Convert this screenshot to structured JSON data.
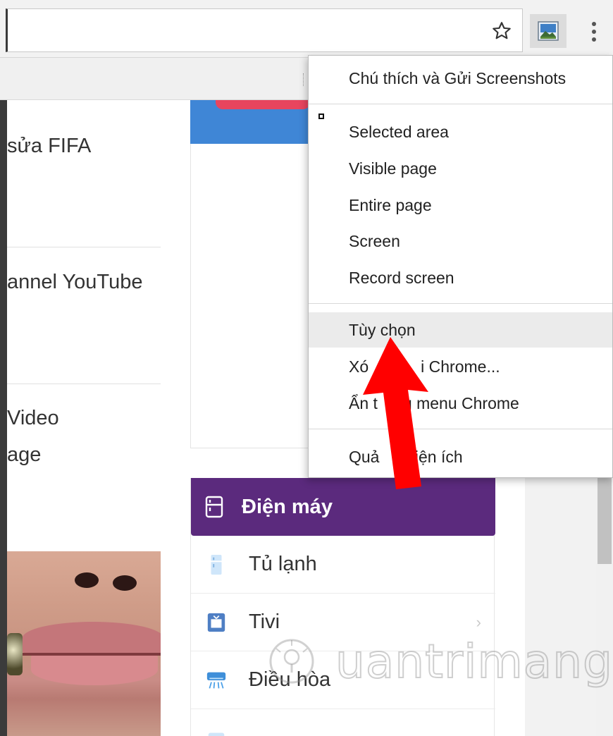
{
  "context_menu": {
    "title_item": "Chú thích và Gửi Screenshots",
    "capture_items": [
      "Selected area",
      "Visible page",
      "Entire page",
      "Screen",
      "Record screen"
    ],
    "option_items": [
      "Tùy chọn",
      "Xóa khỏi Chrome...",
      "Ẩn trong menu Chrome"
    ],
    "manage_item": "Quản lý tiện ích",
    "visible_option_items": [
      "Tùy chọn",
      "Xó",
      "i Chrome...",
      "Ẩn t",
      "g menu Chrome"
    ],
    "visible_manage_item": [
      "Quả",
      "tiện ích"
    ]
  },
  "articles": [
    "sửa FIFA",
    "annel YouTube",
    "Video",
    "age"
  ],
  "categories": {
    "header": "Điện máy",
    "items": [
      "Tủ lạnh",
      "Tivi",
      "Điều hòa"
    ],
    "accent_color": "#5b2a7d"
  },
  "watermark": {
    "text": "uantrimang"
  },
  "colors": {
    "arrow": "#ff0000",
    "hero": "#3f86d6",
    "hero_pill": "#e8455e"
  },
  "icons": {
    "star": "star-icon",
    "extension": "screenshot-extension-icon",
    "menu": "kebab-menu-icon",
    "fridge": "fridge-icon",
    "tv": "tv-icon",
    "ac": "air-conditioner-icon"
  }
}
